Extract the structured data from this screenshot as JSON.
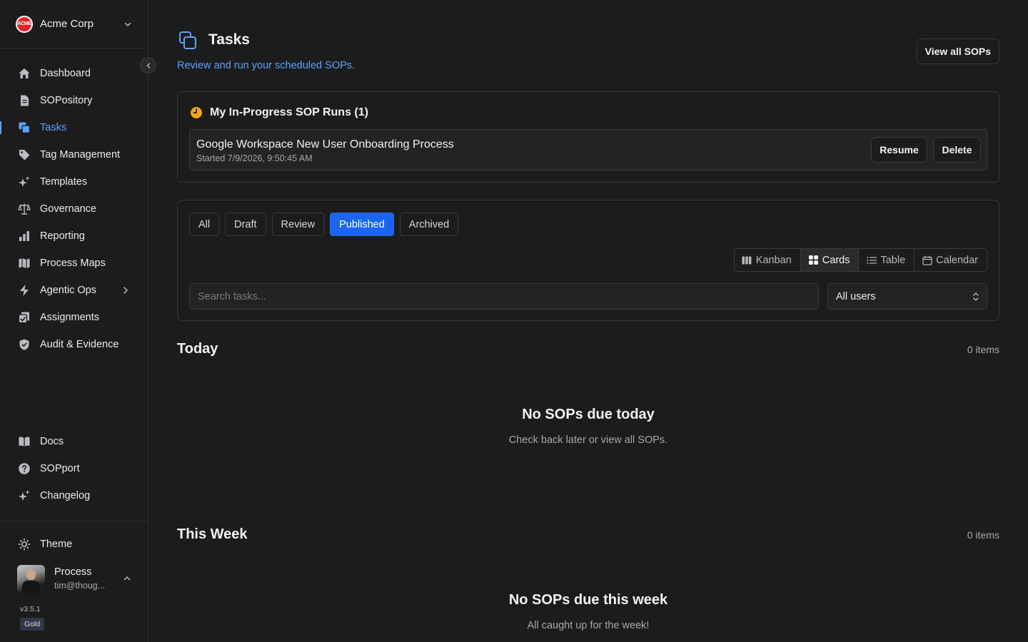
{
  "org": {
    "name": "Acme Corp",
    "logo_text": "ACME"
  },
  "sidebar": {
    "items": [
      {
        "label": "Dashboard",
        "icon": "home-icon"
      },
      {
        "label": "SOPository",
        "icon": "document-icon"
      },
      {
        "label": "Tasks",
        "icon": "tasks-icon",
        "active": true
      },
      {
        "label": "Tag Management",
        "icon": "tag-icon"
      },
      {
        "label": "Templates",
        "icon": "sparkles-icon"
      },
      {
        "label": "Governance",
        "icon": "scale-icon"
      },
      {
        "label": "Reporting",
        "icon": "bar-chart-icon"
      },
      {
        "label": "Process Maps",
        "icon": "map-icon"
      },
      {
        "label": "Agentic Ops",
        "icon": "bolt-icon"
      },
      {
        "label": "Assignments",
        "icon": "assignment-icon"
      },
      {
        "label": "Audit & Evidence",
        "icon": "shield-icon"
      }
    ],
    "bottom_items": [
      {
        "label": "Docs",
        "icon": "book-icon"
      },
      {
        "label": "SOPport",
        "icon": "help-icon"
      },
      {
        "label": "Changelog",
        "icon": "sparkles-icon"
      }
    ],
    "theme_label": "Theme",
    "user": {
      "name": "Process",
      "email": "tim@thoug..."
    },
    "version": "v3.5.1",
    "tier": "Gold"
  },
  "header": {
    "title": "Tasks",
    "subtitle": "Review and run your scheduled SOPs.",
    "view_all_label": "View all SOPs"
  },
  "in_progress": {
    "title": "My In-Progress SOP Runs (1)",
    "runs": [
      {
        "name": "Google Workspace New User Onboarding Process",
        "started": "Started 7/9/2026, 9:50:45 AM",
        "resume_label": "Resume",
        "delete_label": "Delete"
      }
    ]
  },
  "filters": {
    "tabs": [
      "All",
      "Draft",
      "Review",
      "Published",
      "Archived"
    ],
    "active_tab": "Published",
    "views": [
      {
        "label": "Kanban",
        "icon": "kanban-icon"
      },
      {
        "label": "Cards",
        "icon": "grid-icon",
        "active": true
      },
      {
        "label": "Table",
        "icon": "list-icon"
      },
      {
        "label": "Calendar",
        "icon": "calendar-icon"
      }
    ],
    "search_placeholder": "Search tasks...",
    "user_filter": "All users"
  },
  "sections": [
    {
      "title": "Today",
      "count": "0 items",
      "empty_title": "No SOPs due today",
      "empty_sub": "Check back later or view all SOPs."
    },
    {
      "title": "This Week",
      "count": "0 items",
      "empty_title": "No SOPs due this week",
      "empty_sub": "All caught up for the week!"
    }
  ],
  "colors": {
    "accent": "#5aa2ff",
    "primary_button": "#1a66f0",
    "warning": "#f5a516",
    "background": "#1c1c1d"
  }
}
